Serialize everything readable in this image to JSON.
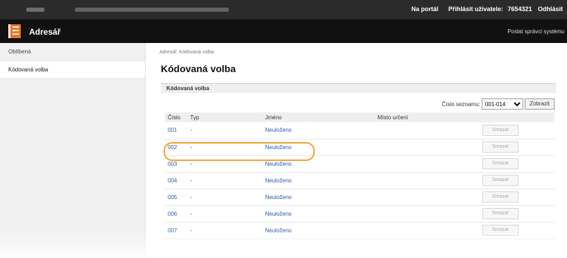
{
  "topbar": {
    "portal_link": "Na portál",
    "login_label": "Přihlásit uživatele:",
    "user_id": "7654321",
    "logout_label": "Odhlásit"
  },
  "header": {
    "title": "Adresář",
    "admin_link": "Poslat správci systému"
  },
  "sidebar": {
    "items": [
      {
        "label": "Oblíbená"
      },
      {
        "label": "Kódovaná volba"
      }
    ]
  },
  "main": {
    "breadcrumb": "Adresář: Kódovaná volba",
    "title": "Kódovaná volba",
    "section_title": "Kódovaná volba",
    "list_label": "Číslo seznamu:",
    "list_selected": "001-014",
    "show_button": "Zobrazit",
    "columns": [
      "Číslo",
      "Typ",
      "Jméno",
      "Místo určení"
    ],
    "rows": [
      {
        "num": "001",
        "type": "-",
        "name": "Neuloženo",
        "dest": "",
        "delete": "Smazat"
      },
      {
        "num": "002",
        "type": "-",
        "name": "Neuloženo",
        "dest": "",
        "delete": "Smazat"
      },
      {
        "num": "003",
        "type": "-",
        "name": "Neuloženo",
        "dest": "",
        "delete": "Smazat"
      },
      {
        "num": "004",
        "type": "-",
        "name": "Neuloženo",
        "dest": "",
        "delete": "Smazat"
      },
      {
        "num": "005",
        "type": "-",
        "name": "Neuloženo",
        "dest": "",
        "delete": "Smazat"
      },
      {
        "num": "006",
        "type": "-",
        "name": "Neuloženo",
        "dest": "",
        "delete": "Smazat"
      },
      {
        "num": "007",
        "type": "-",
        "name": "Neuloženo",
        "dest": "",
        "delete": "Smazat"
      }
    ]
  },
  "colors": {
    "accent": "#ee7326",
    "link": "#2a58a8",
    "highlight": "#f0a030"
  }
}
